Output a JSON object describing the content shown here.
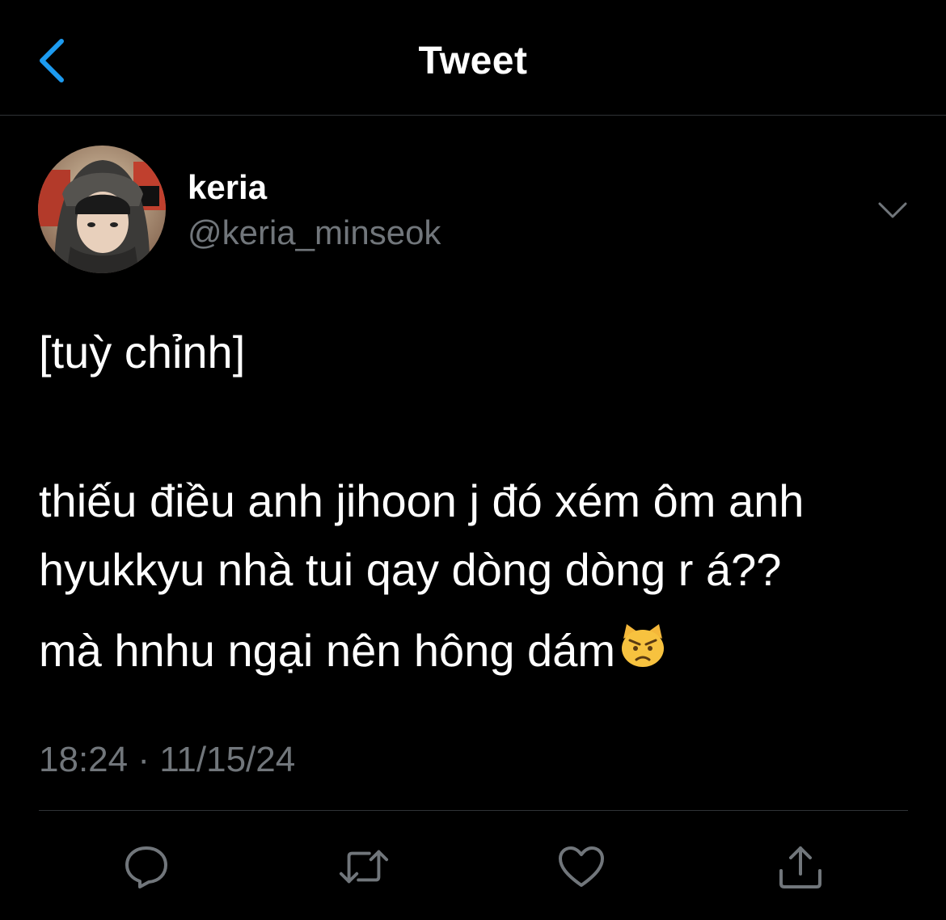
{
  "header": {
    "title": "Tweet",
    "back_icon": "chevron-left-icon",
    "accent": "#1d9bf0"
  },
  "author": {
    "name": "keria",
    "handle": "@keria_minseok",
    "avatar_icon": "avatar-photo"
  },
  "tweet": {
    "lines": [
      "[tuỳ chỉnh]",
      "thiếu điều anh jihoon j đó xém ôm anh",
      "hyukkyu nhà tui qay dòng dòng r á??",
      "mà hnhu ngại nên hông dám"
    ],
    "emoji": "😾",
    "timestamp": "18:24 · 11/15/24"
  },
  "actions": [
    {
      "icon": "reply-icon"
    },
    {
      "icon": "retweet-icon"
    },
    {
      "icon": "like-icon"
    },
    {
      "icon": "share-icon"
    }
  ],
  "colors": {
    "background": "#000000",
    "text": "#ffffff",
    "secondary": "#71767b",
    "border": "#2f3336"
  }
}
